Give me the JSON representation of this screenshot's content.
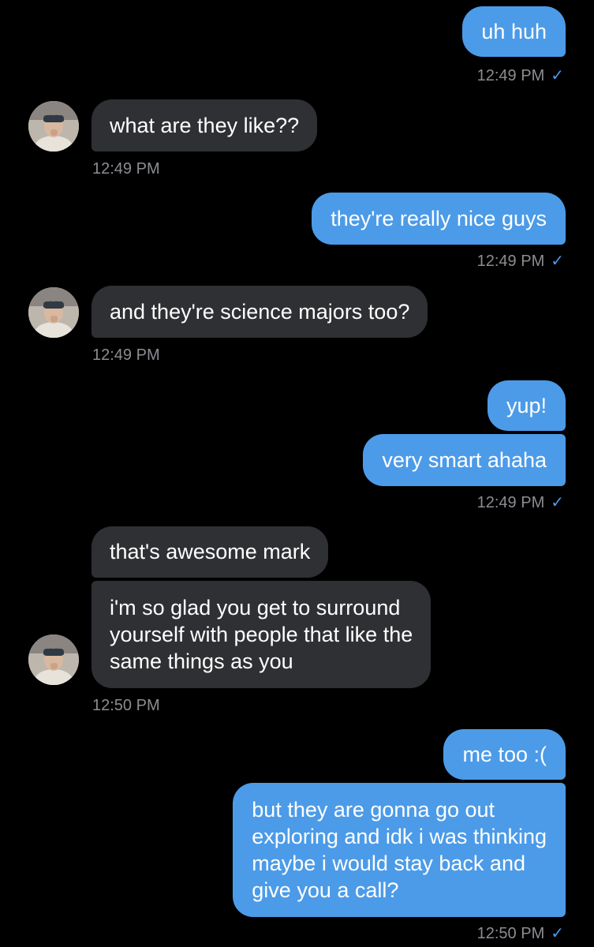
{
  "colors": {
    "background": "#000000",
    "outgoing_bubble": "#4c9be8",
    "incoming_bubble": "#2f3033",
    "timestamp": "#8b8d91",
    "read_check": "#4c9be8"
  },
  "messages": [
    {
      "direction": "out",
      "text": "uh huh",
      "time": "12:49 PM",
      "read_icon": "checkmark-icon"
    },
    {
      "direction": "in",
      "text": "what are they like??",
      "time": "12:49 PM",
      "avatar_icon": "contact-avatar"
    },
    {
      "direction": "out",
      "text": "they're really nice guys",
      "time": "12:49 PM",
      "read_icon": "checkmark-icon"
    },
    {
      "direction": "in",
      "text": "and they're science majors too?",
      "time": "12:49 PM",
      "avatar_icon": "contact-avatar"
    },
    {
      "direction": "out",
      "text": "yup!"
    },
    {
      "direction": "out",
      "text": "very smart ahaha",
      "time": "12:49 PM",
      "read_icon": "checkmark-icon"
    },
    {
      "direction": "in",
      "text": "that's awesome mark"
    },
    {
      "direction": "in",
      "text": "i'm so glad you get to surround\nyourself with people that like the\nsame things as you",
      "time": "12:50 PM",
      "avatar_icon": "contact-avatar"
    },
    {
      "direction": "out",
      "text": "me too :("
    },
    {
      "direction": "out",
      "text": "but they are gonna go out\nexploring and idk i was thinking\nmaybe i would stay back and\ngive you a call?",
      "time": "12:50 PM",
      "read_icon": "checkmark-icon"
    }
  ],
  "check_glyph": "✓"
}
